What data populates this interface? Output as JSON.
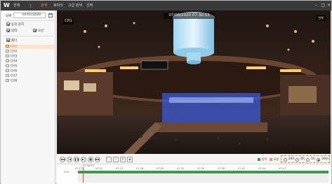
{
  "menu": {
    "logo": "W",
    "items": [
      {
        "label": "전체",
        "active": false
      },
      {
        "label": "검색",
        "active": true
      },
      {
        "label": "북마크",
        "active": false
      },
      {
        "label": "고급 검색",
        "active": false
      },
      {
        "label": "선택",
        "active": false
      }
    ]
  },
  "sidebar": {
    "date_label": "날짜",
    "date_value": "07/07/2020",
    "options": [
      {
        "label": "동작 감지",
        "checked": true
      },
      {
        "label": "입력",
        "checked": true
      },
      {
        "label": "모션",
        "checked": true
      }
    ],
    "group_label": "폴더",
    "channels": [
      "CH1",
      "CH2",
      "CH3",
      "CH4",
      "CH5",
      "CH6",
      "CH7",
      "CH8"
    ],
    "selected_channel": "CH1"
  },
  "video": {
    "channel": "CH1",
    "timestamp": "07/06/2020  07:30:53",
    "fullscreen_label": "전체"
  },
  "controls": {
    "legend": [
      {
        "label": "동작",
        "color": "#3c9a4a"
      },
      {
        "label": "모션",
        "color": "#e8a23a"
      }
    ],
    "scales": [
      {
        "label": "24h",
        "selected": false
      },
      {
        "label": "2h",
        "selected": false
      },
      {
        "label": "1h",
        "selected": false
      },
      {
        "label": "30m",
        "selected": true
      }
    ]
  },
  "timeline": {
    "current_time": "07:30:53",
    "row_label": "CH1",
    "ticks": [
      "07:17",
      "07:20",
      "07:23",
      "07:26",
      "07:29",
      "07:32",
      "07:35",
      "07:38",
      "07:41",
      "07:44",
      "07:47"
    ],
    "recording_color": "#3c9a4a"
  }
}
